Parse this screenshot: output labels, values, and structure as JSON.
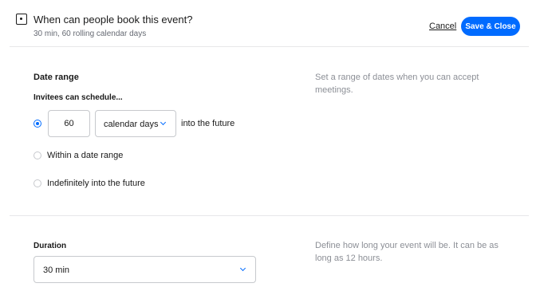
{
  "header": {
    "icon": "event-icon",
    "title": "When can people book this event?",
    "subtitle": "30 min, 60 rolling calendar days",
    "cancel_label": "Cancel",
    "save_label": "Save & Close"
  },
  "date_range": {
    "title": "Date range",
    "sublabel": "Invitees can schedule...",
    "help": "Set a range of dates when you can accept meetings.",
    "days_value": "60",
    "unit_selected": "calendar days",
    "future_text": "into the future",
    "options": [
      {
        "label": "",
        "checked": true
      },
      {
        "label": "Within a date range",
        "checked": false
      },
      {
        "label": "Indefinitely into the future",
        "checked": false
      }
    ]
  },
  "duration": {
    "title": "Duration",
    "help": "Define how long your event will be. It can be as long as 12 hours.",
    "selected": "30 min"
  },
  "colors": {
    "accent": "#006bff",
    "muted_text": "#8c8f96",
    "divider": "#e7e7e9"
  }
}
